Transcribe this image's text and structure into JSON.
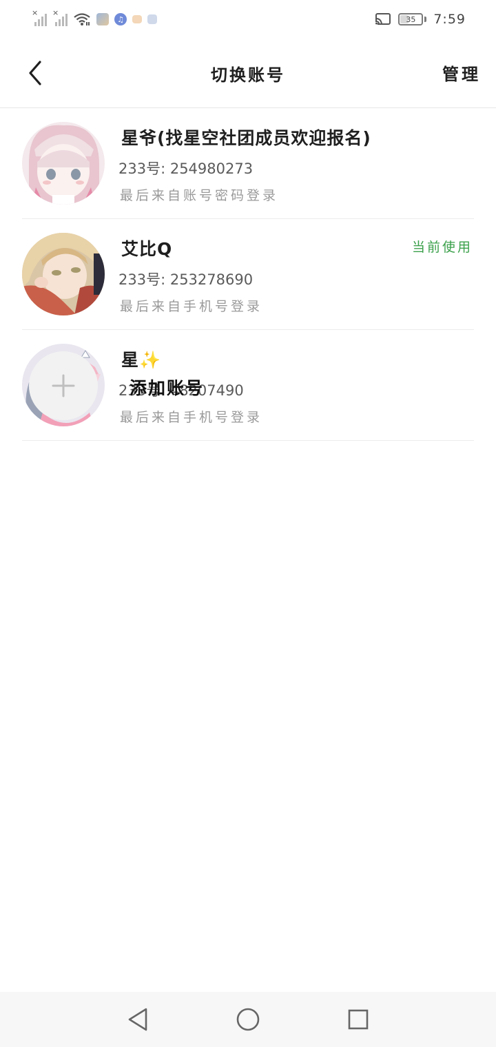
{
  "status_bar": {
    "time": "7:59",
    "battery": "35",
    "battery_level": 0.35,
    "icons": [
      "signal-1-icon",
      "signal-2-icon",
      "wifi-icon",
      "app-notification-icon",
      "music-icon",
      "mail-icon",
      "image-icon",
      "cast-icon",
      "battery-icon"
    ]
  },
  "header": {
    "title": "切换账号",
    "manage_label": "管理",
    "back_icon": "chevron-left-icon"
  },
  "accounts": [
    {
      "name": "星爷(找星空社团成员欢迎报名)",
      "id": "233号: 254980273",
      "login": "最后来自账号密码登录",
      "current": ""
    },
    {
      "name": "艾比Q",
      "id": "233号: 253278690",
      "login": "最后来自手机号登录",
      "current": "当前使用"
    },
    {
      "name": "星✨",
      "id": "233号: 48207490",
      "login": "最后来自手机号登录",
      "current": ""
    }
  ],
  "add_account": {
    "label": "添加账号",
    "icon": "plus-icon"
  },
  "nav_bar": {
    "icons": [
      "back-triangle-icon",
      "home-circle-icon",
      "recents-square-icon"
    ]
  },
  "colors": {
    "current_badge": "#3aa04a",
    "divider": "#ececec",
    "add_circle": "#f2f2f2"
  }
}
